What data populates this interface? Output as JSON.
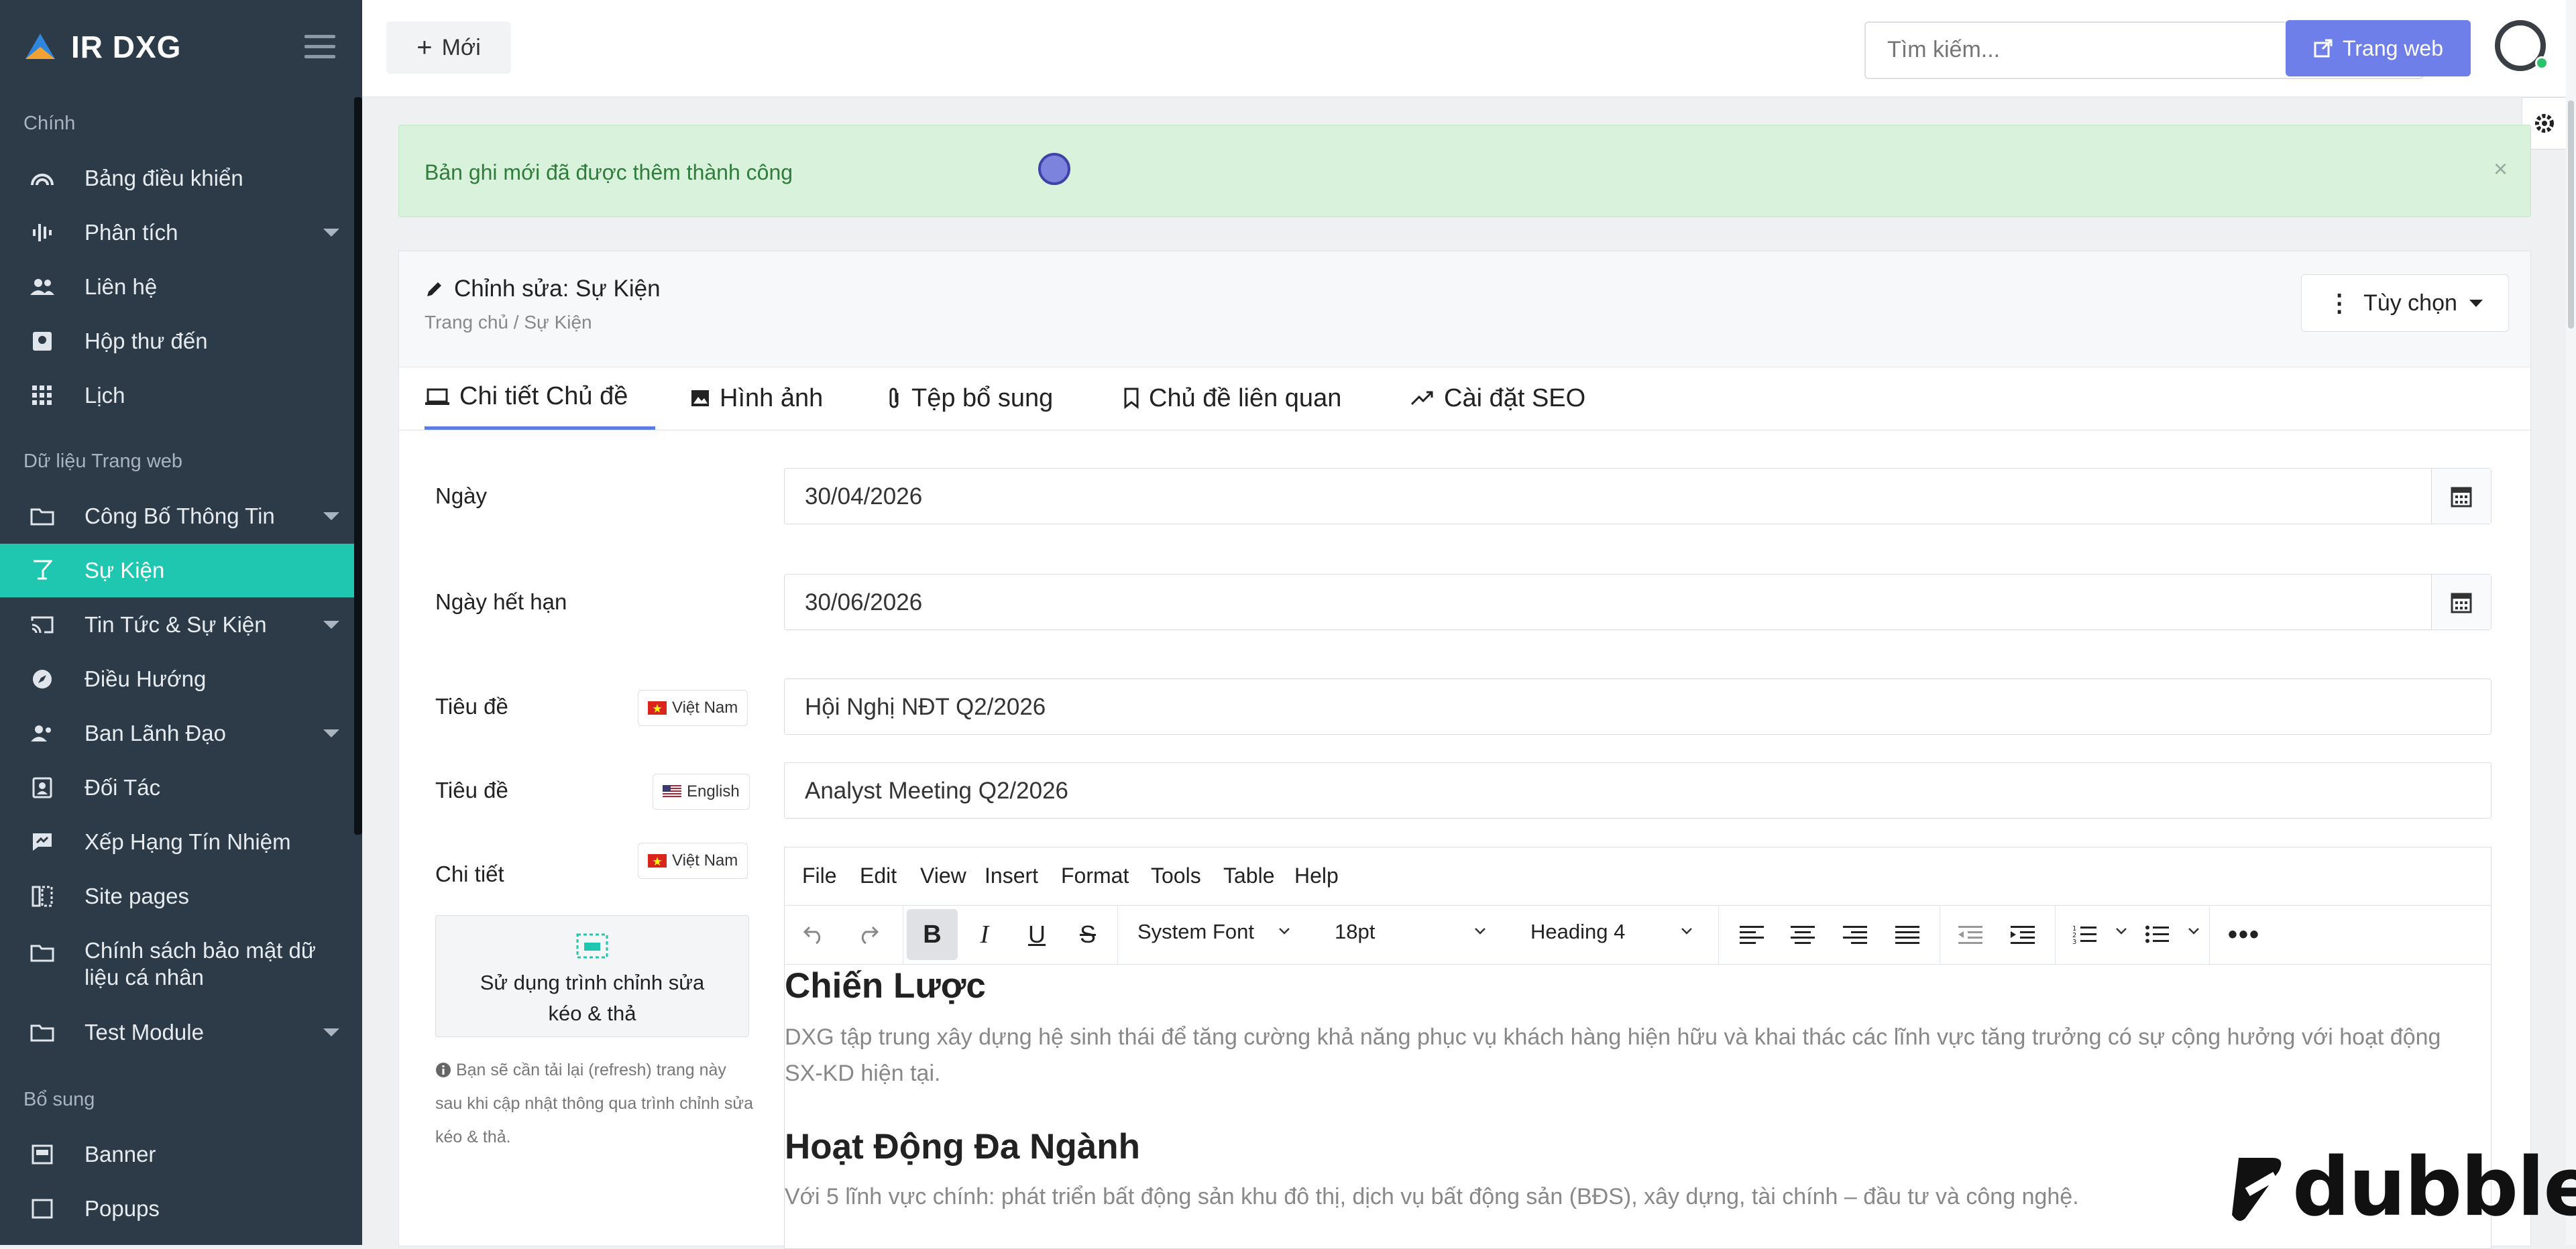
{
  "brand": {
    "name": "IR DXG"
  },
  "sidebar": {
    "sections": [
      "Chính",
      "Dữ liệu Trang web",
      "Bổ sung"
    ],
    "items": [
      {
        "label": "Bảng điều khiển",
        "icon": "dashboard-icon"
      },
      {
        "label": "Phân tích",
        "icon": "analytics-icon",
        "has_submenu": true
      },
      {
        "label": "Liên hệ",
        "icon": "users-icon"
      },
      {
        "label": "Hộp thư đến",
        "icon": "inbox-icon"
      },
      {
        "label": "Lịch",
        "icon": "grid-icon"
      },
      {
        "label": "Công Bố Thông Tin",
        "icon": "folder-icon",
        "has_submenu": true
      },
      {
        "label": "Sự Kiện",
        "icon": "cocktail-icon",
        "active": true
      },
      {
        "label": "Tin Tức & Sự Kiện",
        "icon": "cast-icon",
        "has_submenu": true
      },
      {
        "label": "Điều Hướng",
        "icon": "compass-icon"
      },
      {
        "label": "Ban Lãnh Đạo",
        "icon": "people-icon",
        "has_submenu": true
      },
      {
        "label": "Đối Tác",
        "icon": "contact-card-icon"
      },
      {
        "label": "Xếp Hạng Tín Nhiệm",
        "icon": "rating-icon"
      },
      {
        "label": "Site pages",
        "icon": "pages-icon"
      },
      {
        "label": "Chính sách bảo mật dữ liệu cá nhân",
        "icon": "folder-icon"
      },
      {
        "label": "Test Module",
        "icon": "folder-icon",
        "has_submenu": true
      },
      {
        "label": "Banner",
        "icon": "banner-icon"
      },
      {
        "label": "Popups",
        "icon": "popup-icon"
      }
    ]
  },
  "topbar": {
    "new_label": "Mới",
    "search_placeholder": "Tìm kiếm...",
    "website_label": "Trang web"
  },
  "alert": {
    "message": "Bản ghi mới đã được thêm thành công",
    "close": "×"
  },
  "page": {
    "title": "Chỉnh sửa: Sự Kiện",
    "breadcrumb": "Trang chủ / Sự Kiện",
    "options_label": "Tùy chọn"
  },
  "tabs": [
    "Chi tiết Chủ đề",
    "Hình ảnh",
    "Tệp bổ sung",
    "Chủ đề liên quan",
    "Cài đặt SEO"
  ],
  "form": {
    "date_label": "Ngày",
    "date_value": "30/04/2026",
    "expiry_label": "Ngày hết hạn",
    "expiry_value": "30/06/2026",
    "title_label": "Tiêu đề",
    "title_vi_value": "Hội Nghị NĐT Q2/2026",
    "title_en_value": "Analyst Meeting Q2/2026",
    "details_label": "Chi tiết",
    "lang_vi": "Việt Nam",
    "lang_en": "English"
  },
  "editor": {
    "menu": [
      "File",
      "Edit",
      "View",
      "Insert",
      "Format",
      "Tools",
      "Table",
      "Help"
    ],
    "font_family": "System Font",
    "font_size": "18pt",
    "block_format": "Heading 4",
    "content": {
      "h1": "Chiến Lược",
      "p1": "DXG tập trung xây dựng hệ sinh thái để tăng cường khả năng phục vụ khách hàng hiện hữu và khai thác các lĩnh vực tăng trưởng có sự cộng hưởng với hoạt động SX-KD hiện tại.",
      "h2": "Hoạt Động Đa Ngành",
      "p2": "Với 5 lĩnh vực chính: phát triển bất động sản khu đô thị, dịch vụ bất động sản (BĐS), xây dựng, tài chính – đầu tư và công nghệ."
    }
  },
  "dnd": {
    "button_text": "Sử dụng trình chỉnh sửa kéo & thả",
    "note": "Bạn sẽ cần tải lại (refresh) trang này sau khi cập nhật thông qua trình chỉnh sửa kéo & thả."
  },
  "watermark": "dubble",
  "colors": {
    "sidebar_bg": "#2d3a48",
    "active_item": "#1fc7b1",
    "primary_button": "#6f7fe9",
    "alert_bg": "#d9f2db"
  }
}
